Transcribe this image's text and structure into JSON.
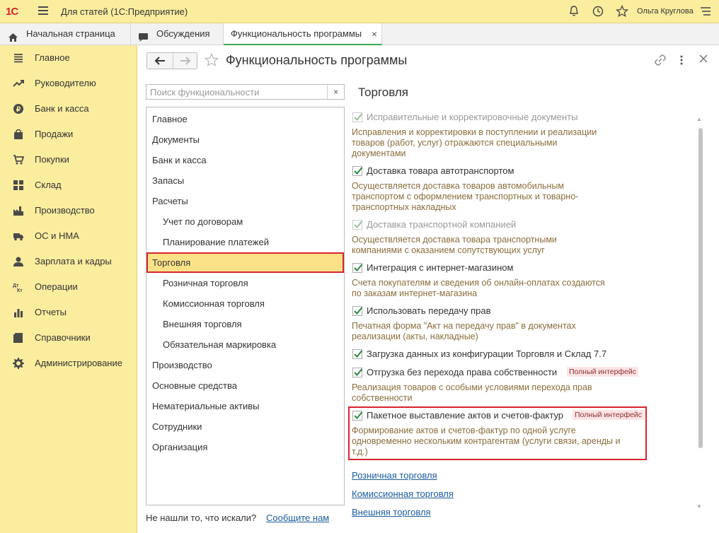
{
  "titlebar": {
    "logo": "1С",
    "app_title": "Для статей  (1С:Предприятие)",
    "user_name": "Ольга Круглова",
    "icons": [
      "bell-icon",
      "history-icon",
      "star-icon",
      "menu-icon"
    ]
  },
  "tabs": [
    {
      "label": "Начальная страница",
      "icon": "home-icon"
    },
    {
      "label": "Обсуждения",
      "icon": "chat-icon"
    },
    {
      "label": "Функциональность программы",
      "active": true
    }
  ],
  "sidebar": {
    "items": [
      {
        "label": "Главное",
        "icon": "menu-icon"
      },
      {
        "label": "Руководителю",
        "icon": "trend-icon"
      },
      {
        "label": "Банк и касса",
        "icon": "coin-icon"
      },
      {
        "label": "Продажи",
        "icon": "bag-icon"
      },
      {
        "label": "Покупки",
        "icon": "cart-icon"
      },
      {
        "label": "Склад",
        "icon": "warehouse-icon"
      },
      {
        "label": "Производство",
        "icon": "factory-icon"
      },
      {
        "label": "ОС и НМА",
        "icon": "truck-icon"
      },
      {
        "label": "Зарплата и кадры",
        "icon": "person-icon"
      },
      {
        "label": "Операции",
        "icon": "dt-kt-icon"
      },
      {
        "label": "Отчеты",
        "icon": "bar-chart-icon"
      },
      {
        "label": "Справочники",
        "icon": "book-icon"
      },
      {
        "label": "Администрирование",
        "icon": "gear-icon"
      }
    ]
  },
  "main": {
    "title": "Функциональность программы",
    "search_placeholder": "Поиск функциональности",
    "search_clear": "×",
    "tree": [
      {
        "label": "Главное",
        "level": 1
      },
      {
        "label": "Документы",
        "level": 1
      },
      {
        "label": "Банк и касса",
        "level": 1
      },
      {
        "label": "Запасы",
        "level": 1
      },
      {
        "label": "Расчеты",
        "level": 1
      },
      {
        "label": "Учет по договорам",
        "level": 2
      },
      {
        "label": "Планирование платежей",
        "level": 2
      },
      {
        "label": "Торговля",
        "level": 1,
        "selected": true
      },
      {
        "label": "Розничная торговля",
        "level": 2
      },
      {
        "label": "Комиссионная торговля",
        "level": 2
      },
      {
        "label": "Внешняя торговля",
        "level": 2
      },
      {
        "label": "Обязательная маркировка",
        "level": 2
      },
      {
        "label": "Производство",
        "level": 1
      },
      {
        "label": "Основные средства",
        "level": 1
      },
      {
        "label": "Нематериальные активы",
        "level": 1
      },
      {
        "label": "Сотрудники",
        "level": 1
      },
      {
        "label": "Организация",
        "level": 1
      }
    ],
    "notfound_text": "Не нашли то, что искали?",
    "notfound_link": "Сообщите нам",
    "section_title": "Торговля",
    "options": [
      {
        "label": "Исправительные и корректировочные документы",
        "checked": true,
        "disabled": true,
        "desc": "Исправления и корректировки в поступлении и реализации товаров (работ, услуг) отражаются специальными документами"
      },
      {
        "label": "Доставка товара автотранспортом",
        "checked": true,
        "disabled": false,
        "desc": "Осуществляется доставка товаров автомобильным транспортом с оформлением транспортных и товарно-транспортных накладных"
      },
      {
        "label": "Доставка транспортной компанией",
        "checked": true,
        "disabled": true,
        "desc": "Осуществляется доставка товара транспортными компаниями с оказанием сопутствующих услуг"
      },
      {
        "label": "Интеграция с интернет-магазином",
        "checked": true,
        "disabled": false,
        "desc": "Счета покупателям и сведения об онлайн-оплатах создаются по заказам интернет-магазина"
      },
      {
        "label": "Использовать передачу прав",
        "checked": true,
        "disabled": false,
        "desc": "Печатная форма \"Акт на передачу прав\" в документах реализации (акты, накладные)"
      },
      {
        "label": "Загрузка данных из конфигурации Торговля и Склад 7.7",
        "checked": true,
        "disabled": false,
        "desc": ""
      },
      {
        "label": "Отгрузка без перехода права собственности",
        "checked": true,
        "disabled": false,
        "badge": "Полный интерфейс",
        "desc": "Реализация товаров с особыми условиями перехода прав собственности"
      },
      {
        "label": "Пакетное выставление актов и счетов-фактур",
        "checked": true,
        "disabled": false,
        "badge": "Полный интерфейс",
        "desc": "Формирование актов и счетов-фактур по одной услуге одновременно нескольким контрагентам (услуги связи, аренды и т.д.)"
      }
    ],
    "links": [
      "Розничная торговля",
      "Комиссионная торговля",
      "Внешняя торговля"
    ]
  }
}
